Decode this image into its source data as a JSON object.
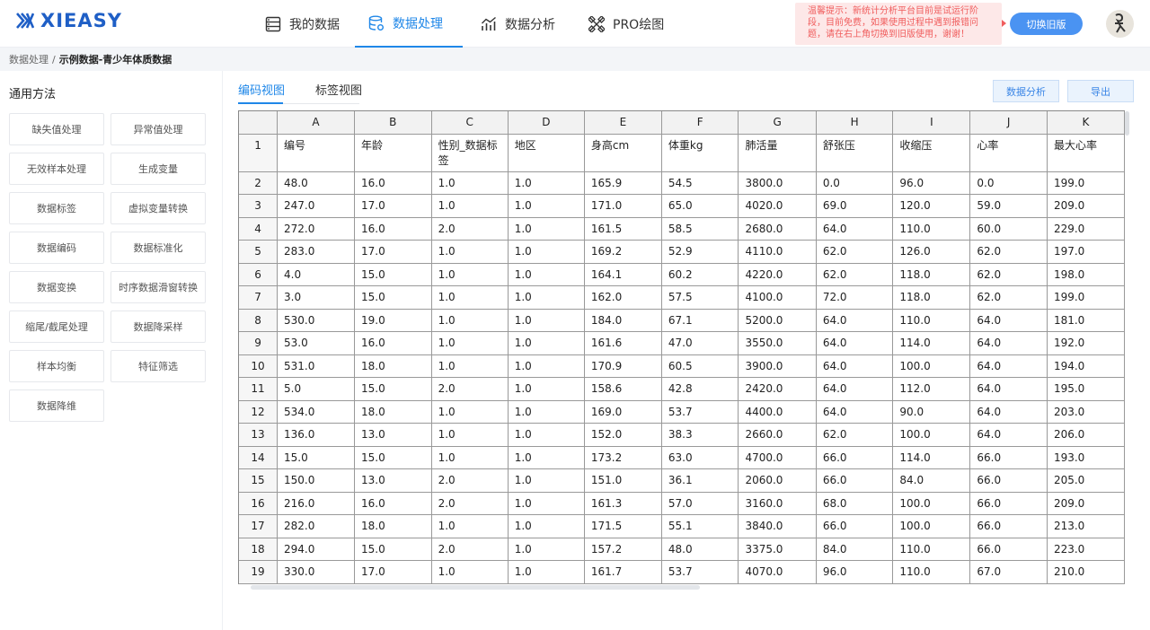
{
  "app": {
    "logo_text": "XIEASY"
  },
  "nav": [
    {
      "label": "我的数据",
      "icon": "database-list-icon"
    },
    {
      "label": "数据处理",
      "icon": "data-process-icon",
      "active": true
    },
    {
      "label": "数据分析",
      "icon": "chart-analysis-icon"
    },
    {
      "label": "PRO绘图",
      "icon": "pro-draw-icon"
    }
  ],
  "notice": {
    "text": "温馨提示：新统计分析平台目前是试运行阶段，目前免费，如果使用过程中遇到报错问题，请在右上角切换到旧版使用，谢谢！"
  },
  "switch_button": "切换旧版",
  "breadcrumb": {
    "root": "数据处理",
    "sep": "/",
    "current": "示例数据-青少年体质数据"
  },
  "sidebar": {
    "title": "通用方法",
    "methods": [
      "缺失值处理",
      "异常值处理",
      "无效样本处理",
      "生成变量",
      "数据标签",
      "虚拟变量转换",
      "数据编码",
      "数据标准化",
      "数据变换",
      "时序数据滑窗转换",
      "缩尾/截尾处理",
      "数据降采样",
      "样本均衡",
      "特征筛选",
      "数据降维"
    ]
  },
  "tabs": [
    {
      "label": "编码视图",
      "active": true
    },
    {
      "label": "标签视图"
    }
  ],
  "actions": {
    "analyze": "数据分析",
    "export": "导出"
  },
  "grid": {
    "columns": [
      "A",
      "B",
      "C",
      "D",
      "E",
      "F",
      "G",
      "H",
      "I",
      "J",
      "K"
    ],
    "header_row_number": "1",
    "header": [
      "编号",
      "年龄",
      "性别_数据标签",
      "地区",
      "身高cm",
      "体重kg",
      "肺活量",
      "舒张压",
      "收缩压",
      "心率",
      "最大心率"
    ],
    "rows": [
      {
        "n": "2",
        "cells": [
          "48.0",
          "16.0",
          "1.0",
          "1.0",
          "165.9",
          "54.5",
          "3800.0",
          "0.0",
          "96.0",
          "0.0",
          "199.0"
        ]
      },
      {
        "n": "3",
        "cells": [
          "247.0",
          "17.0",
          "1.0",
          "1.0",
          "171.0",
          "65.0",
          "4020.0",
          "69.0",
          "120.0",
          "59.0",
          "209.0"
        ]
      },
      {
        "n": "4",
        "cells": [
          "272.0",
          "16.0",
          "2.0",
          "1.0",
          "161.5",
          "58.5",
          "2680.0",
          "64.0",
          "110.0",
          "60.0",
          "229.0"
        ]
      },
      {
        "n": "5",
        "cells": [
          "283.0",
          "17.0",
          "1.0",
          "1.0",
          "169.2",
          "52.9",
          "4110.0",
          "62.0",
          "126.0",
          "62.0",
          "197.0"
        ]
      },
      {
        "n": "6",
        "cells": [
          "4.0",
          "15.0",
          "1.0",
          "1.0",
          "164.1",
          "60.2",
          "4220.0",
          "62.0",
          "118.0",
          "62.0",
          "198.0"
        ]
      },
      {
        "n": "7",
        "cells": [
          "3.0",
          "15.0",
          "1.0",
          "1.0",
          "162.0",
          "57.5",
          "4100.0",
          "72.0",
          "118.0",
          "62.0",
          "199.0"
        ]
      },
      {
        "n": "8",
        "cells": [
          "530.0",
          "19.0",
          "1.0",
          "1.0",
          "184.0",
          "67.1",
          "5200.0",
          "64.0",
          "110.0",
          "64.0",
          "181.0"
        ]
      },
      {
        "n": "9",
        "cells": [
          "53.0",
          "16.0",
          "1.0",
          "1.0",
          "161.6",
          "47.0",
          "3550.0",
          "64.0",
          "114.0",
          "64.0",
          "192.0"
        ]
      },
      {
        "n": "10",
        "cells": [
          "531.0",
          "18.0",
          "1.0",
          "1.0",
          "170.9",
          "60.5",
          "3900.0",
          "64.0",
          "100.0",
          "64.0",
          "194.0"
        ]
      },
      {
        "n": "11",
        "cells": [
          "5.0",
          "15.0",
          "2.0",
          "1.0",
          "158.6",
          "42.8",
          "2420.0",
          "64.0",
          "112.0",
          "64.0",
          "195.0"
        ]
      },
      {
        "n": "12",
        "cells": [
          "534.0",
          "18.0",
          "1.0",
          "1.0",
          "169.0",
          "53.7",
          "4400.0",
          "64.0",
          "90.0",
          "64.0",
          "203.0"
        ]
      },
      {
        "n": "13",
        "cells": [
          "136.0",
          "13.0",
          "1.0",
          "1.0",
          "152.0",
          "38.3",
          "2660.0",
          "62.0",
          "100.0",
          "64.0",
          "206.0"
        ]
      },
      {
        "n": "14",
        "cells": [
          "15.0",
          "15.0",
          "1.0",
          "1.0",
          "173.2",
          "63.0",
          "4700.0",
          "66.0",
          "114.0",
          "66.0",
          "193.0"
        ]
      },
      {
        "n": "15",
        "cells": [
          "150.0",
          "13.0",
          "2.0",
          "1.0",
          "151.0",
          "36.1",
          "2060.0",
          "66.0",
          "84.0",
          "66.0",
          "205.0"
        ]
      },
      {
        "n": "16",
        "cells": [
          "216.0",
          "16.0",
          "2.0",
          "1.0",
          "161.3",
          "57.0",
          "3160.0",
          "68.0",
          "100.0",
          "66.0",
          "209.0"
        ]
      },
      {
        "n": "17",
        "cells": [
          "282.0",
          "18.0",
          "1.0",
          "1.0",
          "171.5",
          "55.1",
          "3840.0",
          "66.0",
          "100.0",
          "66.0",
          "213.0"
        ]
      },
      {
        "n": "18",
        "cells": [
          "294.0",
          "15.0",
          "2.0",
          "1.0",
          "157.2",
          "48.0",
          "3375.0",
          "84.0",
          "110.0",
          "66.0",
          "223.0"
        ]
      },
      {
        "n": "19",
        "cells": [
          "330.0",
          "17.0",
          "1.0",
          "1.0",
          "161.7",
          "53.7",
          "4070.0",
          "96.0",
          "110.0",
          "67.0",
          "210.0"
        ]
      }
    ]
  },
  "colors": {
    "accent": "#1f87e8",
    "logo": "#1f5fc6",
    "notice_bg": "#fde8e8",
    "notice_text": "#f05d5d",
    "switch_btn": "#4a93f2"
  }
}
